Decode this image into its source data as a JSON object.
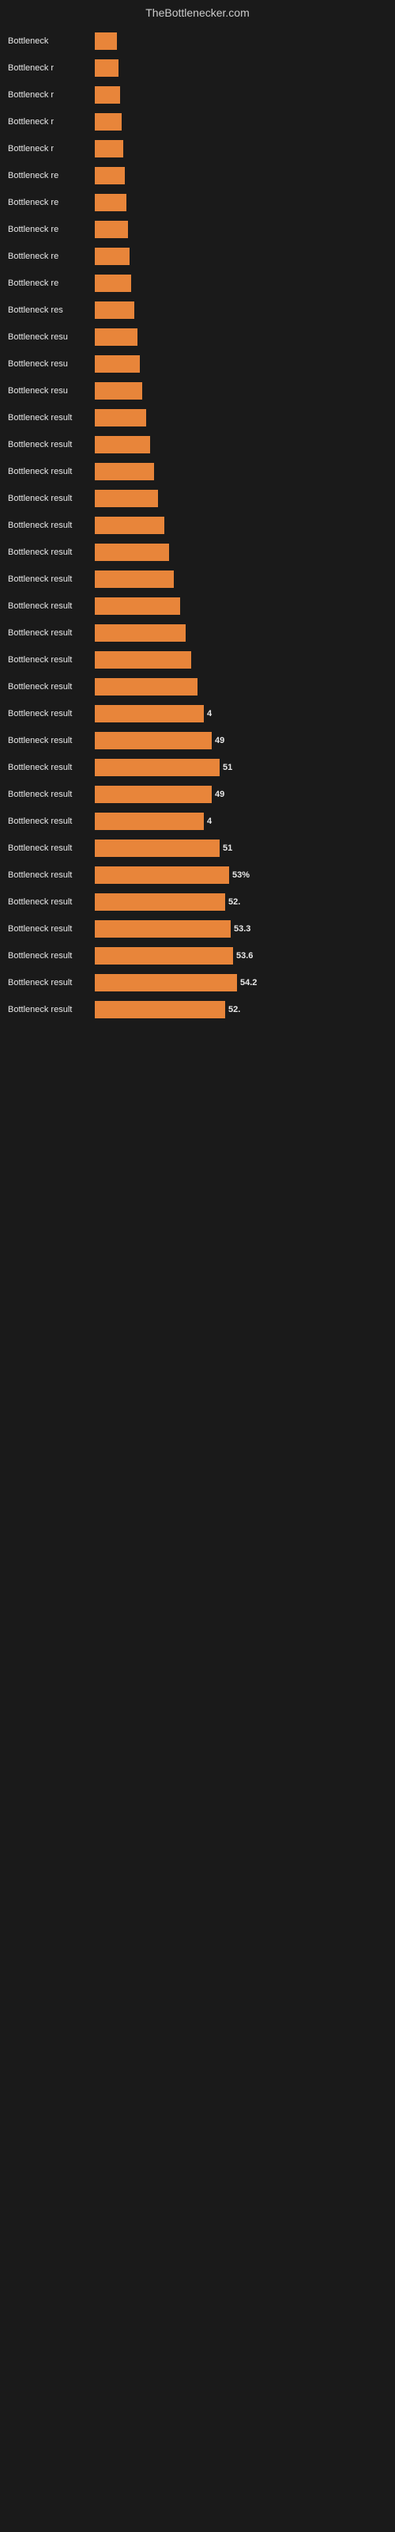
{
  "header": {
    "title": "TheBottlenecker.com"
  },
  "bars": [
    {
      "label": "Bottleneck",
      "value": null,
      "width": 28,
      "showValue": false
    },
    {
      "label": "Bottleneck r",
      "value": null,
      "width": 30,
      "showValue": false
    },
    {
      "label": "Bottleneck r",
      "value": null,
      "width": 32,
      "showValue": false
    },
    {
      "label": "Bottleneck r",
      "value": null,
      "width": 34,
      "showValue": false
    },
    {
      "label": "Bottleneck r",
      "value": null,
      "width": 36,
      "showValue": false
    },
    {
      "label": "Bottleneck re",
      "value": null,
      "width": 38,
      "showValue": false
    },
    {
      "label": "Bottleneck re",
      "value": null,
      "width": 40,
      "showValue": false
    },
    {
      "label": "Bottleneck re",
      "value": null,
      "width": 42,
      "showValue": false
    },
    {
      "label": "Bottleneck re",
      "value": null,
      "width": 44,
      "showValue": false
    },
    {
      "label": "Bottleneck re",
      "value": null,
      "width": 46,
      "showValue": false
    },
    {
      "label": "Bottleneck res",
      "value": null,
      "width": 50,
      "showValue": false
    },
    {
      "label": "Bottleneck resu",
      "value": null,
      "width": 54,
      "showValue": false
    },
    {
      "label": "Bottleneck resu",
      "value": null,
      "width": 57,
      "showValue": false
    },
    {
      "label": "Bottleneck resu",
      "value": null,
      "width": 60,
      "showValue": false
    },
    {
      "label": "Bottleneck result",
      "value": null,
      "width": 65,
      "showValue": false
    },
    {
      "label": "Bottleneck result",
      "value": null,
      "width": 70,
      "showValue": false
    },
    {
      "label": "Bottleneck result",
      "value": null,
      "width": 75,
      "showValue": false
    },
    {
      "label": "Bottleneck result",
      "value": null,
      "width": 80,
      "showValue": false
    },
    {
      "label": "Bottleneck result",
      "value": null,
      "width": 88,
      "showValue": false
    },
    {
      "label": "Bottleneck result",
      "value": null,
      "width": 94,
      "showValue": false
    },
    {
      "label": "Bottleneck result",
      "value": null,
      "width": 100,
      "showValue": false
    },
    {
      "label": "Bottleneck result",
      "value": null,
      "width": 108,
      "showValue": false
    },
    {
      "label": "Bottleneck result",
      "value": null,
      "width": 115,
      "showValue": false
    },
    {
      "label": "Bottleneck result",
      "value": null,
      "width": 122,
      "showValue": false
    },
    {
      "label": "Bottleneck result",
      "value": null,
      "width": 130,
      "showValue": false
    },
    {
      "label": "Bottleneck result",
      "value": "4",
      "width": 138,
      "showValue": true
    },
    {
      "label": "Bottleneck result",
      "value": "49",
      "width": 148,
      "showValue": true
    },
    {
      "label": "Bottleneck result",
      "value": "51",
      "width": 158,
      "showValue": true
    },
    {
      "label": "Bottleneck result",
      "value": "49",
      "width": 148,
      "showValue": true
    },
    {
      "label": "Bottleneck result",
      "value": "4",
      "width": 138,
      "showValue": true
    },
    {
      "label": "Bottleneck result",
      "value": "51",
      "width": 158,
      "showValue": true
    },
    {
      "label": "Bottleneck result",
      "value": "53%",
      "width": 170,
      "showValue": true
    },
    {
      "label": "Bottleneck result",
      "value": "52.",
      "width": 165,
      "showValue": true
    },
    {
      "label": "Bottleneck result",
      "value": "53.3",
      "width": 172,
      "showValue": true
    },
    {
      "label": "Bottleneck result",
      "value": "53.6",
      "width": 175,
      "showValue": true
    },
    {
      "label": "Bottleneck result",
      "value": "54.2",
      "width": 180,
      "showValue": true
    },
    {
      "label": "Bottleneck result",
      "value": "52.",
      "width": 165,
      "showValue": true
    }
  ]
}
